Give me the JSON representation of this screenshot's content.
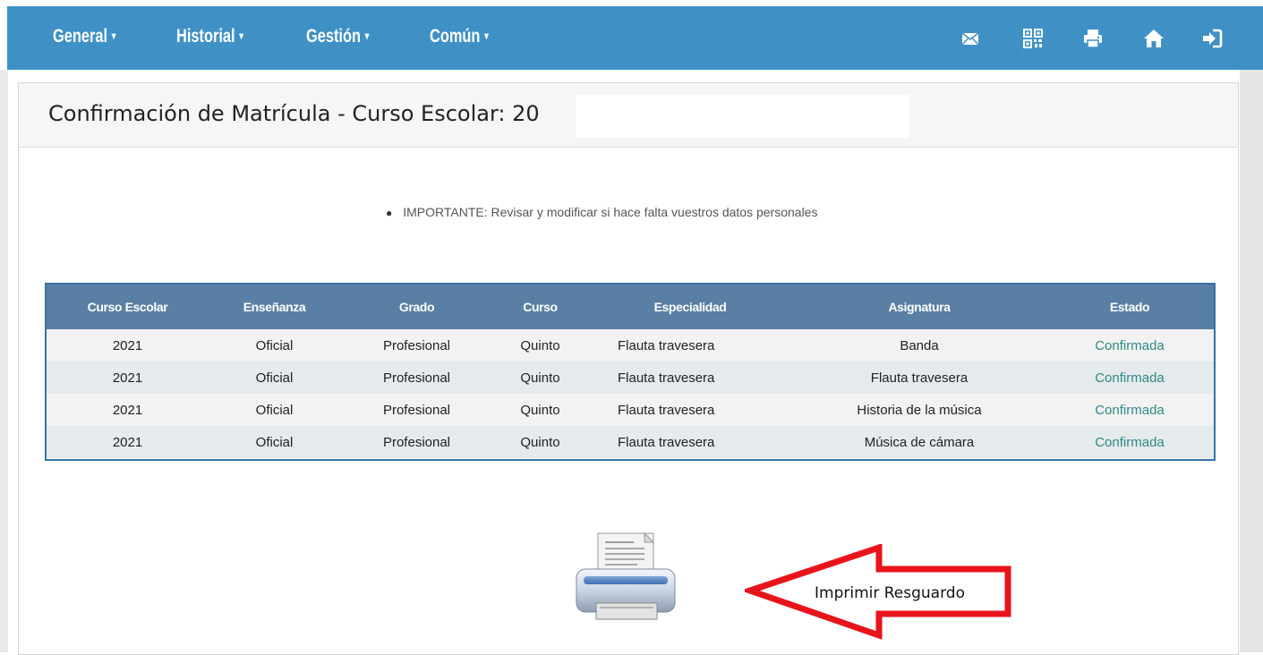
{
  "navbar": {
    "menus": [
      "General",
      "Historial",
      "Gestión",
      "Común"
    ],
    "caret": "▾",
    "icons": [
      "envelope-icon",
      "qr-code-icon",
      "print-icon",
      "home-icon",
      "logout-icon"
    ],
    "background_color": "#3f91c5"
  },
  "page": {
    "title": "Confirmación de Matrícula - Curso Escolar: 20",
    "notice": "IMPORTANTE: Revisar y modificar si hace falta vuestros datos personales"
  },
  "table": {
    "headers": [
      "Curso Escolar",
      "Enseñanza",
      "Grado",
      "Curso",
      "Especialidad",
      "Asignatura",
      "Estado"
    ],
    "rows": [
      [
        "2021",
        "Oficial",
        "Profesional",
        "Quinto",
        "Flauta travesera",
        "Banda",
        "Confirmada"
      ],
      [
        "2021",
        "Oficial",
        "Profesional",
        "Quinto",
        "Flauta travesera",
        "Flauta travesera",
        "Confirmada"
      ],
      [
        "2021",
        "Oficial",
        "Profesional",
        "Quinto",
        "Flauta travesera",
        "Historia de la música",
        "Confirmada"
      ],
      [
        "2021",
        "Oficial",
        "Profesional",
        "Quinto",
        "Flauta travesera",
        "Música de cámara",
        "Confirmada"
      ]
    ],
    "header_color": "#5a7fa4",
    "status_color": "#2e8a86"
  },
  "print": {
    "label": "Imprimir Resguardo",
    "icon": "printer-icon",
    "annotation_color": "#e8141b"
  }
}
